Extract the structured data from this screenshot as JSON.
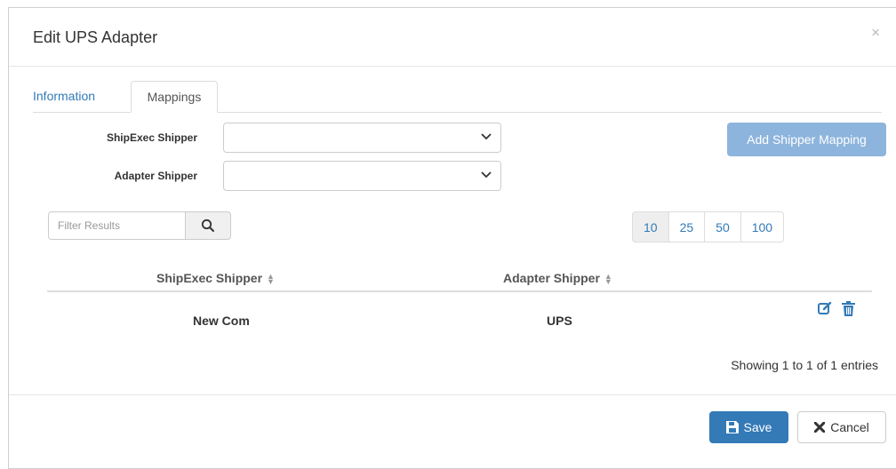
{
  "dialog": {
    "title": "Edit UPS Adapter",
    "close_glyph": "×"
  },
  "tabs": [
    {
      "label": "Information",
      "active": false
    },
    {
      "label": "Mappings",
      "active": true
    }
  ],
  "form": {
    "shipexec_label": "ShipExec Shipper",
    "shipexec_value": "",
    "adapter_label": "Adapter Shipper",
    "adapter_value": "",
    "add_button_label": "Add Shipper Mapping"
  },
  "filter": {
    "placeholder": "Filter Results",
    "search_icon": "search-icon"
  },
  "page_size": {
    "options": [
      "10",
      "25",
      "50",
      "100"
    ],
    "selected": "10"
  },
  "table": {
    "columns": [
      "ShipExec Shipper",
      "Adapter Shipper"
    ],
    "sort_glyph": "⬍",
    "rows": [
      {
        "shipexec": "New Com",
        "adapter": "UPS"
      }
    ],
    "row_actions": [
      "edit-icon",
      "trash-icon"
    ],
    "info": "Showing 1 to 1 of 1 entries"
  },
  "footer": {
    "save_label": "Save",
    "cancel_label": "Cancel"
  },
  "colors": {
    "primary": "#337ab7",
    "add_button": "#8db4dc",
    "active_page": "#eeeeee"
  }
}
